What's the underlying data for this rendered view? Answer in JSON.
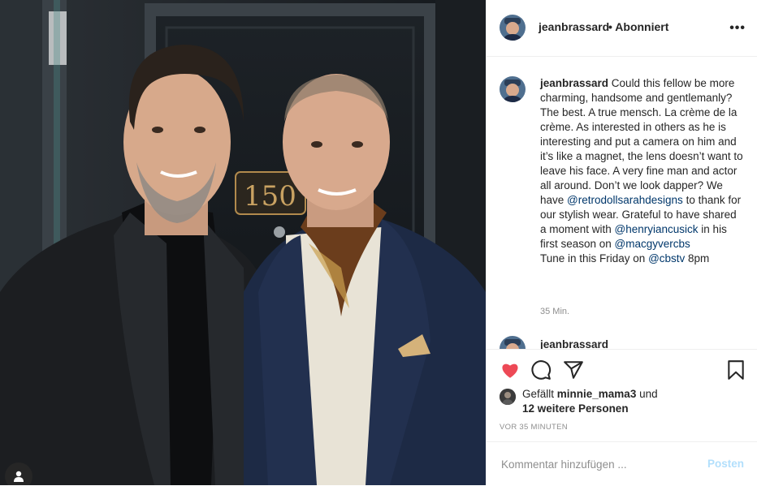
{
  "post": {
    "photo_name": "post-photo",
    "door_number": "150"
  },
  "header": {
    "username": "jeanbrassard",
    "separator": "•",
    "follow_status": "Abonniert",
    "more_icon": "more-horizontal-icon"
  },
  "caption": {
    "username": "jeanbrassard",
    "text_1": " Could this fellow be more charming, handsome and gentlemanly? The best. A true mensch. La crème de la crème. As interested in others as he is interesting and put a camera on him and it’s like a magnet, the lens doesn’t want to leave his face. A very fine man and actor all around. Don’t we look dapper? We have ",
    "mention_1": "@retrodollsarahdesigns",
    "text_2": " to thank for our stylish wear. Grateful to have shared a moment with ",
    "mention_2": "@henryiancusick",
    "text_3": " in his first season on ",
    "mention_3": "@macgyvercbs",
    "text_4": "Tune in this Friday on ",
    "mention_4": "@cbstv",
    "text_5": " 8pm",
    "time": "35 Min."
  },
  "next_comment": {
    "username": "jeanbrassard"
  },
  "actions": {
    "like_icon": "heart-filled-icon",
    "comment_icon": "comment-icon",
    "share_icon": "send-icon",
    "save_icon": "bookmark-icon",
    "like_color": "#ed4956"
  },
  "likes": {
    "prefix": "Gefällt ",
    "user": "minnie_mama3",
    "middle": " und",
    "others": "12 weitere Personen"
  },
  "post_time": "VOR 35 MINUTEN",
  "comment_box": {
    "placeholder": "Kommentar hinzufügen ...",
    "post_label": "Posten"
  }
}
